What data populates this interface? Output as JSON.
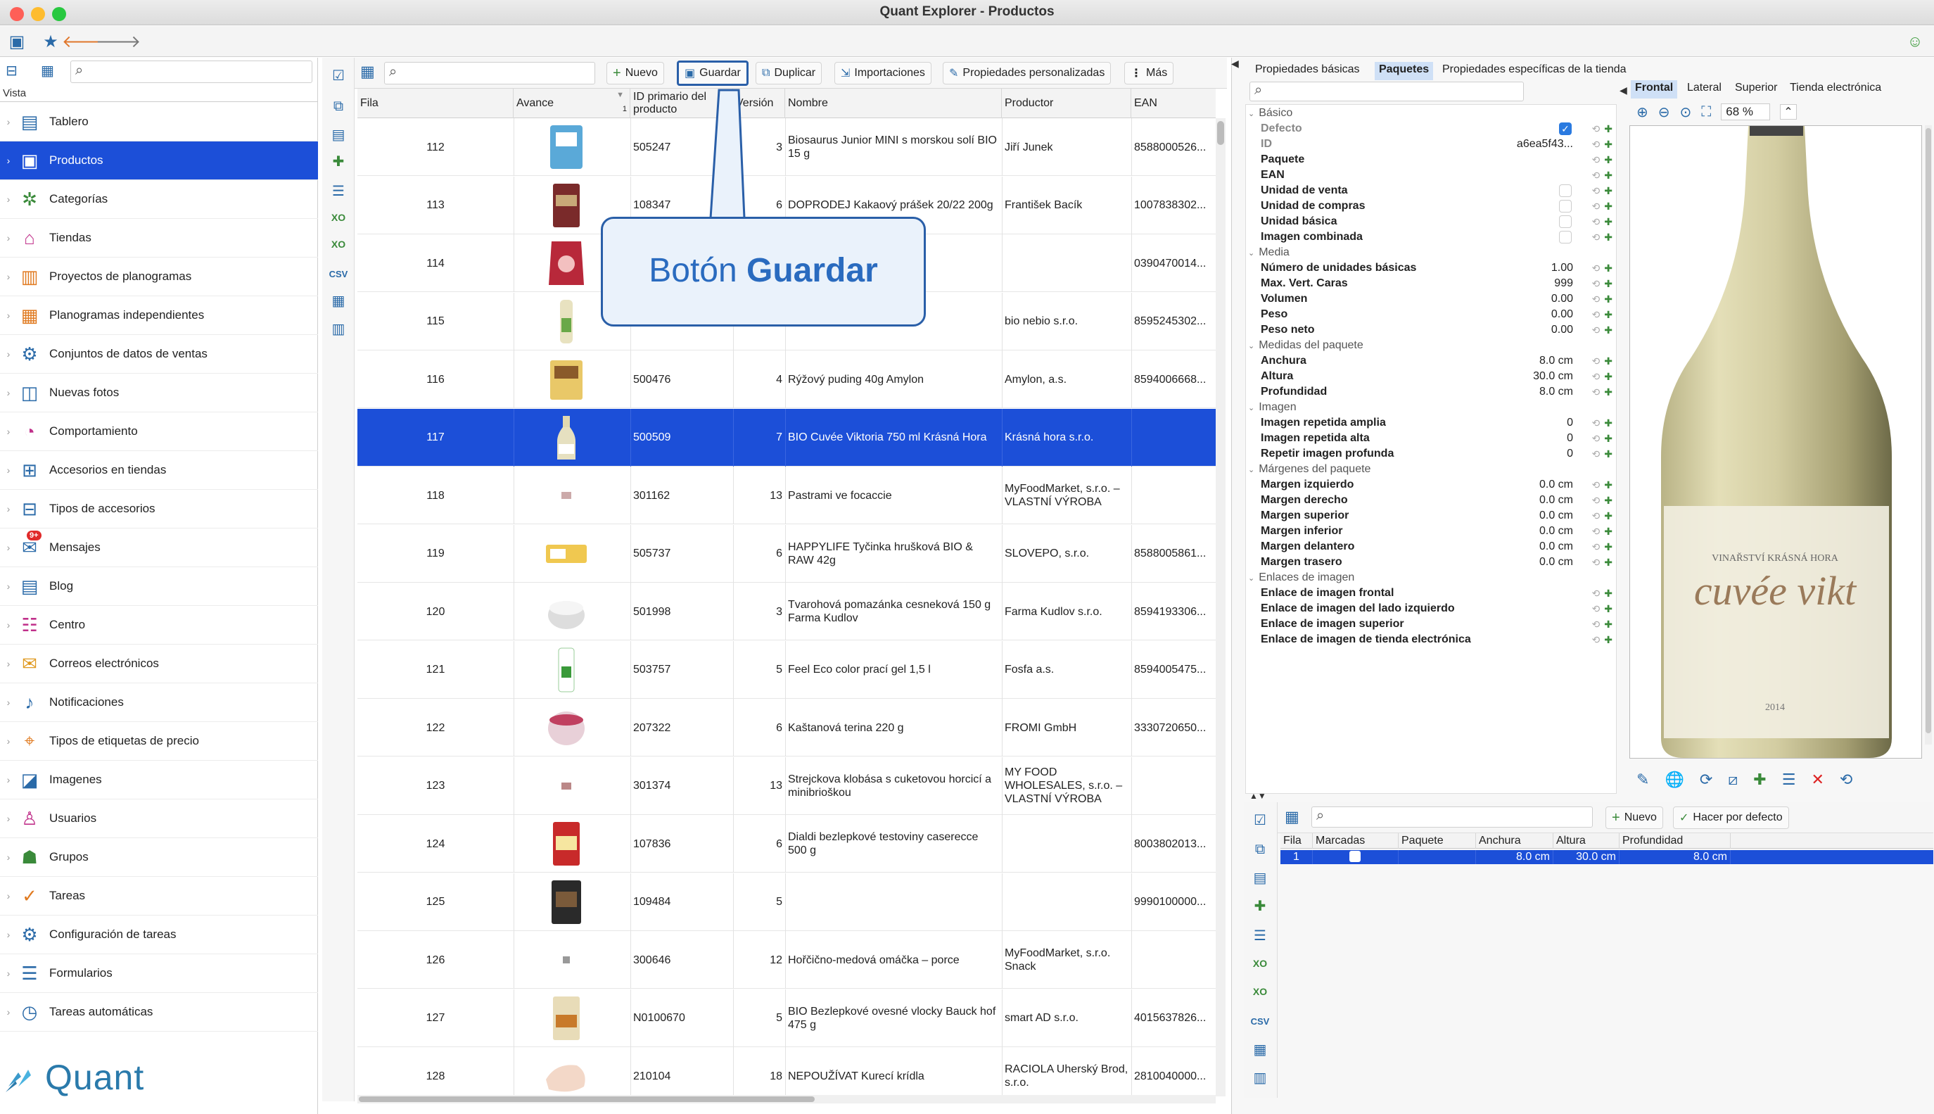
{
  "window": {
    "title": "Quant Explorer - Productos"
  },
  "sidebar": {
    "header_label": "Vista",
    "items": [
      {
        "label": "Tablero",
        "icon": "dashboard-icon"
      },
      {
        "label": "Productos",
        "icon": "products-icon",
        "selected": true
      },
      {
        "label": "Categorías",
        "icon": "categories-icon"
      },
      {
        "label": "Tiendas",
        "icon": "store-icon"
      },
      {
        "label": "Proyectos de planogramas",
        "icon": "planogram-project-icon"
      },
      {
        "label": "Planogramas independientes",
        "icon": "planogram-icon"
      },
      {
        "label": "Conjuntos de datos de ventas",
        "icon": "sales-data-icon"
      },
      {
        "label": "Nuevas fotos",
        "icon": "photos-icon"
      },
      {
        "label": "Comportamiento",
        "icon": "behavior-icon"
      },
      {
        "label": "Accesorios en tiendas",
        "icon": "accessories-icon"
      },
      {
        "label": "Tipos de accesorios",
        "icon": "accessory-types-icon"
      },
      {
        "label": "Mensajes",
        "icon": "messages-icon",
        "badge": "9+"
      },
      {
        "label": "Blog",
        "icon": "blog-icon"
      },
      {
        "label": "Centro",
        "icon": "center-icon"
      },
      {
        "label": "Correos electrónicos",
        "icon": "mail-icon"
      },
      {
        "label": "Notificaciones",
        "icon": "bell-icon"
      },
      {
        "label": "Tipos de etiquetas de precio",
        "icon": "price-tag-icon"
      },
      {
        "label": "Imagenes",
        "icon": "image-icon"
      },
      {
        "label": "Usuarios",
        "icon": "user-icon"
      },
      {
        "label": "Grupos",
        "icon": "group-icon"
      },
      {
        "label": "Tareas",
        "icon": "task-icon"
      },
      {
        "label": "Configuración de tareas",
        "icon": "task-settings-icon"
      },
      {
        "label": "Formularios",
        "icon": "form-icon"
      },
      {
        "label": "Tareas automáticas",
        "icon": "auto-task-icon"
      }
    ],
    "logo_text": "Quant"
  },
  "grid_toolbar": {
    "new_label": "Nuevo",
    "save_label": "Guardar",
    "duplicate_label": "Duplicar",
    "imports_label": "Importaciones",
    "custom_props_label": "Propiedades personalizadas",
    "more_label": "Más"
  },
  "columns": [
    "Fila",
    "Avance",
    "ID primario del producto",
    "Versión",
    "Nombre",
    "Productor",
    "EAN"
  ],
  "avance_sort_index": "1",
  "rows": [
    {
      "fila": "112",
      "id": "505247",
      "version": "3",
      "nombre": "Biosaurus Junior MINI s morskou solí BIO 15 g",
      "productor": "Jiří Junek",
      "ean": "8588000526..."
    },
    {
      "fila": "113",
      "id": "108347",
      "version": "6",
      "nombre": "DOPRODEJ Kakaový prášek 20/22 200g",
      "productor": "František Bacík",
      "ean": "1007838302..."
    },
    {
      "fila": "114",
      "id": "",
      "version": "",
      "nombre": "",
      "productor": "",
      "ean": "0390470014..."
    },
    {
      "fila": "115",
      "id": "",
      "version": "",
      "nombre": "",
      "productor": "bio nebio s.r.o.",
      "ean": "8595245302..."
    },
    {
      "fila": "116",
      "id": "500476",
      "version": "4",
      "nombre": "Rýžový puding 40g Amylon",
      "productor": "Amylon, a.s.",
      "ean": "8594006668..."
    },
    {
      "fila": "117",
      "id": "500509",
      "version": "7",
      "nombre": "BIO Cuvée Viktoria 750 ml Krásná Hora",
      "productor": "Krásná hora s.r.o.",
      "ean": "",
      "selected": true
    },
    {
      "fila": "118",
      "id": "301162",
      "version": "13",
      "nombre": "Pastrami ve focaccie",
      "productor": "MyFoodMarket, s.r.o. – VLASTNÍ VÝROBA",
      "ean": ""
    },
    {
      "fila": "119",
      "id": "505737",
      "version": "6",
      "nombre": "HAPPYLIFE Tyčinka hrušková BIO & RAW 42g",
      "productor": "SLOVEPO, s.r.o.",
      "ean": "8588005861..."
    },
    {
      "fila": "120",
      "id": "501998",
      "version": "3",
      "nombre": "Tvarohová pomazánka cesneková 150 g Farma Kudlov",
      "productor": "Farma Kudlov s.r.o.",
      "ean": "8594193306..."
    },
    {
      "fila": "121",
      "id": "503757",
      "version": "5",
      "nombre": "Feel Eco color prací gel 1,5 l",
      "productor": "Fosfa a.s.",
      "ean": "8594005475..."
    },
    {
      "fila": "122",
      "id": "207322",
      "version": "6",
      "nombre": "Kaštanová terina 220 g",
      "productor": "FROMI GmbH",
      "ean": "3330720650..."
    },
    {
      "fila": "123",
      "id": "301374",
      "version": "13",
      "nombre": "Strejckova klobása  s cuketovou horcicí a minibrioškou",
      "productor": "MY FOOD WHOLESALES, s.r.o. – VLASTNÍ VÝROBA",
      "ean": ""
    },
    {
      "fila": "124",
      "id": "107836",
      "version": "6",
      "nombre": "Dialdi bezlepkové testoviny caserecce 500 g",
      "productor": "",
      "ean": "8003802013..."
    },
    {
      "fila": "125",
      "id": "109484",
      "version": "5",
      "nombre": "",
      "productor": "",
      "ean": "9990100000..."
    },
    {
      "fila": "126",
      "id": "300646",
      "version": "12",
      "nombre": "Hořčično-medová omáčka – porce",
      "productor": "MyFoodMarket, s.r.o. Snack",
      "ean": ""
    },
    {
      "fila": "127",
      "id": "N0100670",
      "version": "5",
      "nombre": "BIO Bezlepkové ovesné vlocky Bauck hof 475 g",
      "productor": "smart AD s.r.o.",
      "ean": "4015637826..."
    },
    {
      "fila": "128",
      "id": "210104",
      "version": "18",
      "nombre": "NEPOUŽÍVAT Kurecí krídla",
      "productor": "RACIOLA Uherský Brod, s.r.o.",
      "ean": "2810040000..."
    }
  ],
  "callout": {
    "text_prefix": "Botón ",
    "text_bold": "Guardar"
  },
  "props_tabs": [
    "Propiedades básicas",
    "Paquetes",
    "Propiedades específicas de la tienda"
  ],
  "properties": [
    {
      "type": "section",
      "label": "Básico"
    },
    {
      "label": "Defecto",
      "value": "",
      "checkbox": "checked",
      "muted": true
    },
    {
      "label": "ID",
      "value": "a6ea5f43...",
      "muted": true
    },
    {
      "label": "Paquete",
      "value": ""
    },
    {
      "label": "EAN",
      "value": ""
    },
    {
      "label": "Unidad de venta",
      "value": "",
      "checkbox": "empty"
    },
    {
      "label": "Unidad de compras",
      "value": "",
      "checkbox": "empty"
    },
    {
      "label": "Unidad básica",
      "value": "",
      "checkbox": "empty"
    },
    {
      "label": "Imagen combinada",
      "value": "",
      "checkbox": "empty"
    },
    {
      "type": "section",
      "label": "Media"
    },
    {
      "label": "Número de unidades básicas",
      "value": "1.00"
    },
    {
      "label": "Max. Vert. Caras",
      "value": "999"
    },
    {
      "label": "Volumen",
      "value": "0.00"
    },
    {
      "label": "Peso",
      "value": "0.00"
    },
    {
      "label": "Peso neto",
      "value": "0.00"
    },
    {
      "type": "section",
      "label": "Medidas del paquete"
    },
    {
      "label": "Anchura",
      "value": "8.0 cm"
    },
    {
      "label": "Altura",
      "value": "30.0 cm"
    },
    {
      "label": "Profundidad",
      "value": "8.0 cm"
    },
    {
      "type": "section",
      "label": "Imagen"
    },
    {
      "label": "Imagen repetida amplia",
      "value": "0"
    },
    {
      "label": "Imagen repetida alta",
      "value": "0"
    },
    {
      "label": "Repetir imagen profunda",
      "value": "0"
    },
    {
      "type": "section",
      "label": "Márgenes del paquete"
    },
    {
      "label": "Margen izquierdo",
      "value": "0.0 cm"
    },
    {
      "label": "Margen derecho",
      "value": "0.0 cm"
    },
    {
      "label": "Margen superior",
      "value": "0.0 cm"
    },
    {
      "label": "Margen inferior",
      "value": "0.0 cm"
    },
    {
      "label": "Margen delantero",
      "value": "0.0 cm"
    },
    {
      "label": "Margen trasero",
      "value": "0.0 cm"
    },
    {
      "type": "section",
      "label": "Enlaces de imagen"
    },
    {
      "label": "Enlace de imagen frontal",
      "value": ""
    },
    {
      "label": "Enlace de imagen del lado izquierdo",
      "value": ""
    },
    {
      "label": "Enlace de imagen superior",
      "value": ""
    },
    {
      "label": "Enlace de imagen de tienda electrónica",
      "value": ""
    }
  ],
  "image_tabs": [
    "Frontal",
    "Lateral",
    "Superior",
    "Tienda electrónica"
  ],
  "zoom": "68 %",
  "bottle_label": {
    "brand": "VINAŘSTVÍ KRÁSNÁ HORA",
    "name": "cuvée vikt",
    "year": "2014"
  },
  "package_table": {
    "new_label": "Nuevo",
    "default_label": "Hacer por defecto",
    "columns": [
      "Fila",
      "Marcadas",
      "Paquete",
      "Anchura",
      "Altura",
      "Profundidad"
    ],
    "rows": [
      {
        "fila": "1",
        "paquete": "",
        "anchura": "8.0 cm",
        "altura": "30.0 cm",
        "profundidad": "8.0 cm"
      }
    ]
  },
  "colors": {
    "accent": "#1c4fd8",
    "callout_border": "#2a5fa8",
    "callout_text": "#2a6bbf"
  }
}
